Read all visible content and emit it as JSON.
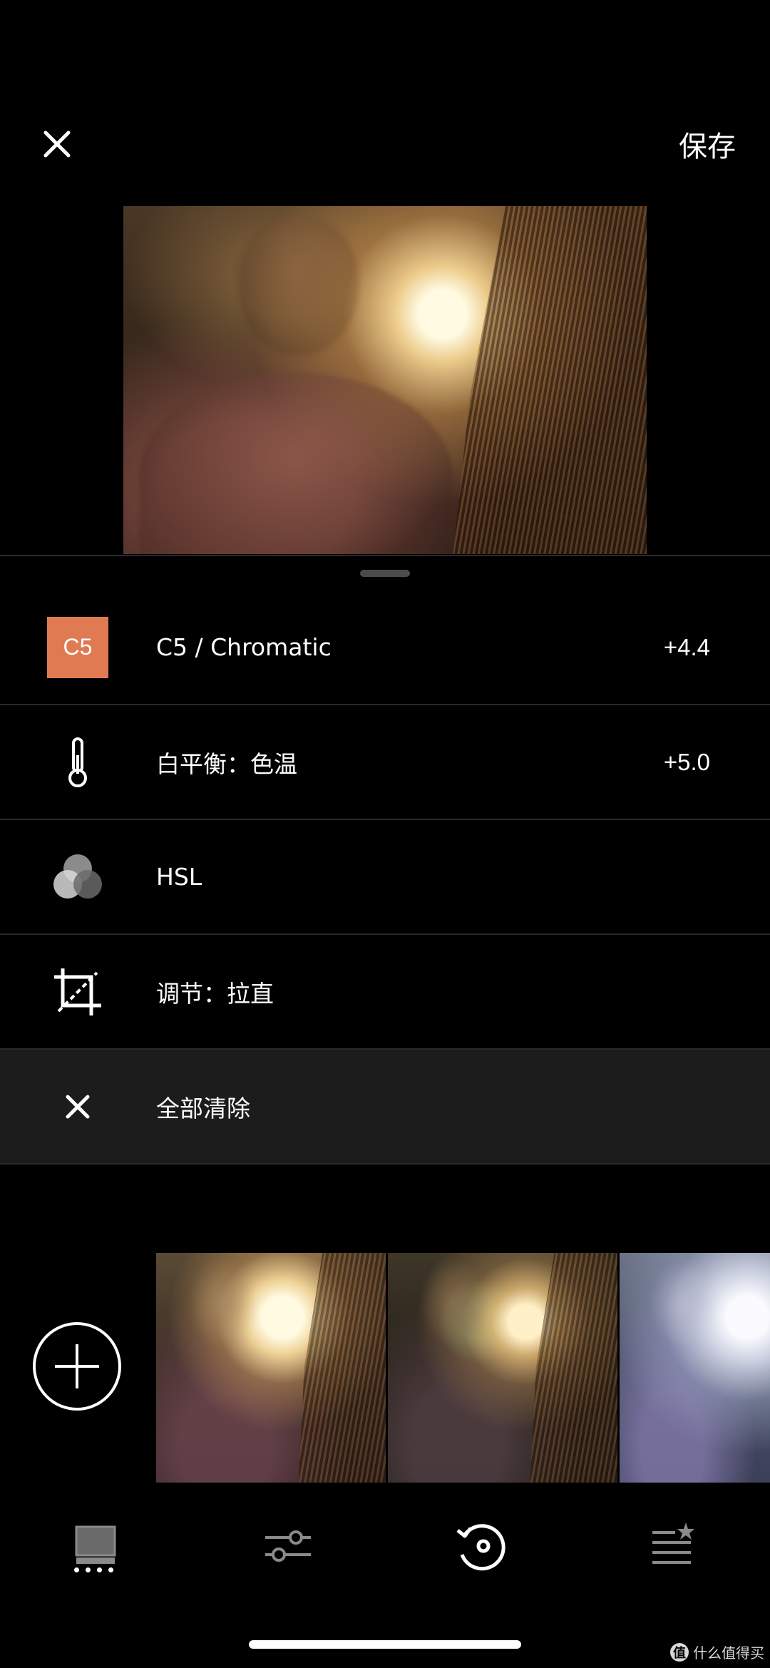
{
  "header": {
    "close_icon": "close-icon",
    "save_label": "保存"
  },
  "adjustments": [
    {
      "name": "preset",
      "badge": "C5",
      "label": "C5 / Chromatic",
      "value": "+4.4",
      "badge_color": "#e07a52"
    },
    {
      "name": "white-balance",
      "icon": "thermometer-icon",
      "label": "白平衡：色温",
      "value": "+5.0"
    },
    {
      "name": "hsl",
      "icon": "hsl-circles-icon",
      "label": "HSL",
      "value": ""
    },
    {
      "name": "adjust",
      "icon": "crop-straighten-icon",
      "label": "调节：拉直",
      "value": ""
    },
    {
      "name": "clear-all",
      "icon": "close-icon",
      "label": "全部清除",
      "value": ""
    }
  ],
  "recipes": {
    "add_icon": "plus-icon",
    "thumbnails": [
      "recipe-thumbnail-1",
      "recipe-thumbnail-2",
      "recipe-thumbnail-3"
    ]
  },
  "tabbar": {
    "tabs": [
      {
        "name": "presets",
        "icon": "presets-icon",
        "active": false
      },
      {
        "name": "tools",
        "icon": "sliders-icon",
        "active": false
      },
      {
        "name": "history",
        "icon": "history-icon",
        "active": true
      },
      {
        "name": "recipes",
        "icon": "recipes-star-icon",
        "active": false
      }
    ]
  },
  "watermark": {
    "icon_text": "值",
    "text": "什么值得买"
  },
  "colors": {
    "background": "#000000",
    "accent": "#e07a52",
    "divider": "#2a2a2a",
    "selected_row": "#1c1c1c"
  }
}
